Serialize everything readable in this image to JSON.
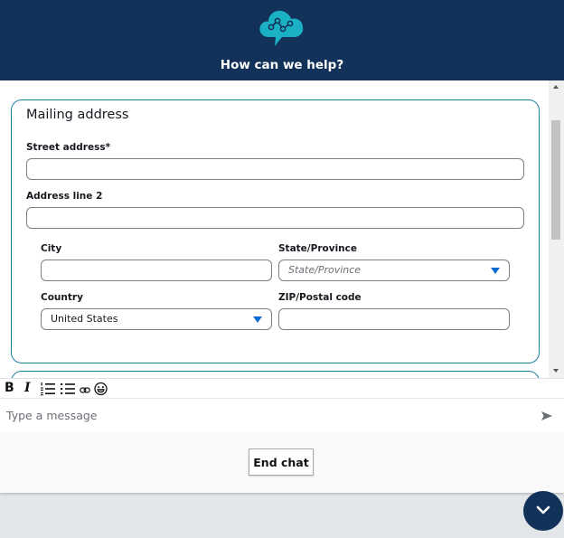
{
  "header": {
    "title": "How can we help?",
    "logo_icon": "cloud-chat-network-icon"
  },
  "form": {
    "title": "Mailing address",
    "fields": {
      "street": {
        "label": "Street address*",
        "value": ""
      },
      "address2": {
        "label": "Address line 2",
        "value": ""
      },
      "city": {
        "label": "City",
        "value": ""
      },
      "state": {
        "label": "State/Province",
        "placeholder": "State/Province",
        "value": ""
      },
      "country": {
        "label": "Country",
        "value": "United States"
      },
      "zip": {
        "label": "ZIP/Postal code",
        "value": ""
      }
    }
  },
  "toolbar": {
    "bold": "B",
    "italic": "I",
    "icons": [
      "bold-icon",
      "italic-icon",
      "numbered-list-icon",
      "bulleted-list-icon",
      "link-icon",
      "emoji-icon"
    ]
  },
  "composer": {
    "placeholder": "Type a message",
    "value": ""
  },
  "footer": {
    "end_chat_label": "End chat"
  },
  "colors": {
    "header_bg": "#13325a",
    "accent_teal": "#1f7ea1",
    "logo_teal": "#1ab1c4",
    "dropdown_caret": "#0a6ccf"
  }
}
